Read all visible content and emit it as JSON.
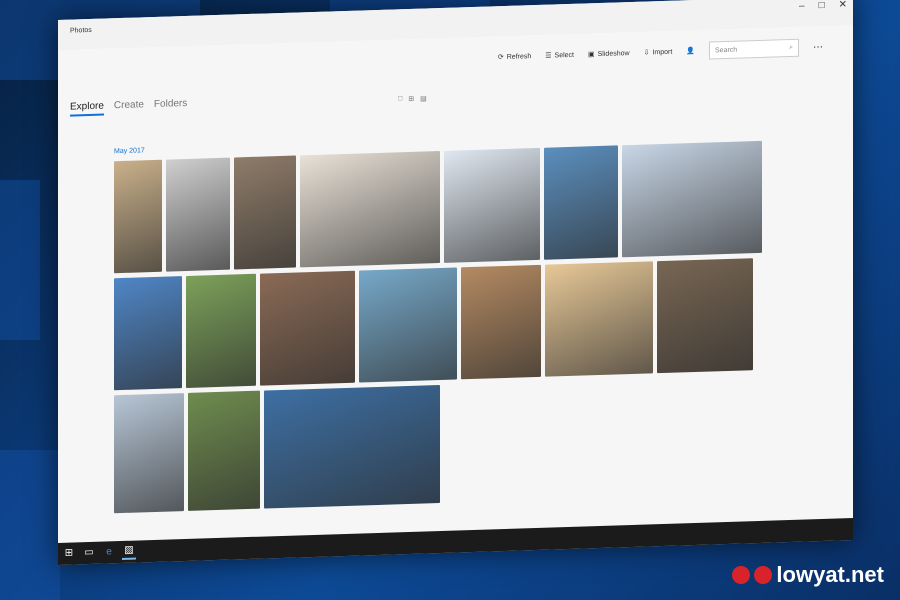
{
  "app": {
    "title": "Photos"
  },
  "toolbar": {
    "refresh": "Refresh",
    "select": "Select",
    "slideshow": "Slideshow",
    "import": "Import",
    "search_placeholder": "Search"
  },
  "tabs": [
    {
      "label": "Explore"
    },
    {
      "label": "Create"
    },
    {
      "label": "Folders"
    }
  ],
  "gallery": {
    "month": "May 2017"
  },
  "photos": {
    "row1": [
      "#c9b08a",
      "#cfcfcf",
      "#8f7c69",
      "#e8e1d6",
      "#dfe7f0",
      "#5b8fbe",
      "#c8d6e6"
    ],
    "row2": [
      "#4f86c6",
      "#7ca15a",
      "#8a6a55",
      "#76a8c8",
      "#b48a62",
      "#e7c897",
      "#786653"
    ],
    "row3": [
      "#b7c6d6",
      "#6f8c4f",
      "#3d6fa3"
    ]
  },
  "watermark": "lowyat.net"
}
